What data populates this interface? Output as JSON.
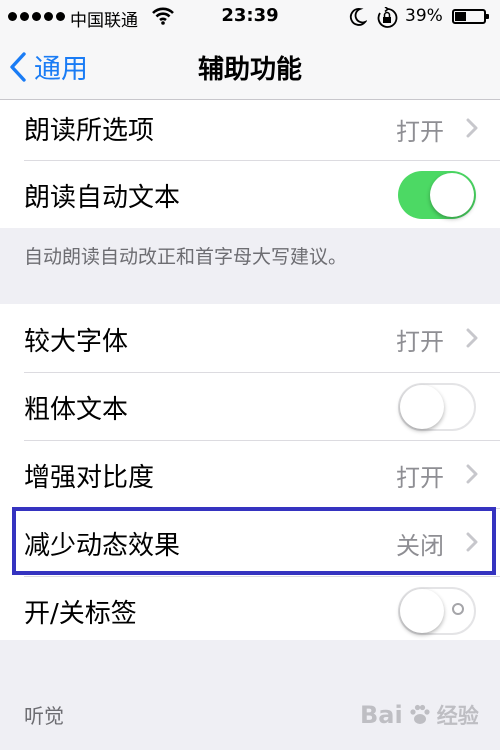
{
  "status_bar": {
    "carrier": "中国联通",
    "time": "23:39",
    "battery": "39%",
    "battery_level": 0.39
  },
  "nav": {
    "back_label": "通用",
    "title": "辅助功能"
  },
  "group1": {
    "speak_selection": {
      "label": "朗读所选项",
      "value": "打开"
    },
    "speak_auto_text": {
      "label": "朗读自动文本",
      "state": "on"
    },
    "footnote": "自动朗读自动改正和首字母大写建议。"
  },
  "group2": {
    "larger_text": {
      "label": "较大字体",
      "value": "打开"
    },
    "bold_text": {
      "label": "粗体文本",
      "state": "off"
    },
    "increase_contrast": {
      "label": "增强对比度",
      "value": "打开"
    },
    "reduce_motion": {
      "label": "减少动态效果",
      "value": "关闭"
    },
    "on_off_labels": {
      "label": "开/关标签",
      "state": "off"
    }
  },
  "hearing_header": "听觉",
  "watermark": {
    "brand": "Bai",
    "suffix": "经验"
  },
  "colors": {
    "accent": "#1a7cf5",
    "toggle_on": "#4cd964",
    "highlight": "#3533c0",
    "background": "#efeff4"
  },
  "icons": {
    "back": "chevron-left-icon",
    "disclosure": "chevron-right-icon",
    "wifi": "wifi-icon",
    "moon": "moon-icon",
    "rotation_lock": "rotation-lock-icon",
    "battery": "battery-icon"
  }
}
